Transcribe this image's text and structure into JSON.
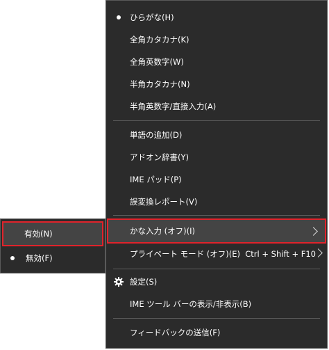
{
  "main_menu": {
    "items": [
      {
        "label": "ひらがな(H)"
      },
      {
        "label": "全角カタカナ(K)"
      },
      {
        "label": "全角英数字(W)"
      },
      {
        "label": "半角カタカナ(N)"
      },
      {
        "label": "半角英数字/直接入力(A)"
      },
      {
        "label": "単語の追加(D)"
      },
      {
        "label": "アドオン辞書(Y)"
      },
      {
        "label": "IME パッド(P)"
      },
      {
        "label": "誤変換レポート(V)"
      },
      {
        "label": "かな入力 (オフ)(I)"
      },
      {
        "label": "プライベート モード (オフ)(E)",
        "shortcut": "Ctrl + Shift + F10"
      },
      {
        "label": "設定(S)"
      },
      {
        "label": "IME ツール バーの表示/非表示(B)"
      },
      {
        "label": "フィードバックの送信(F)"
      }
    ]
  },
  "submenu": {
    "items": [
      {
        "label": "有効(N)"
      },
      {
        "label": "無効(F)"
      }
    ]
  },
  "colors": {
    "menu_background": "#2b2b2b",
    "highlight_border": "#e0232b",
    "highlight_background": "#444444"
  }
}
